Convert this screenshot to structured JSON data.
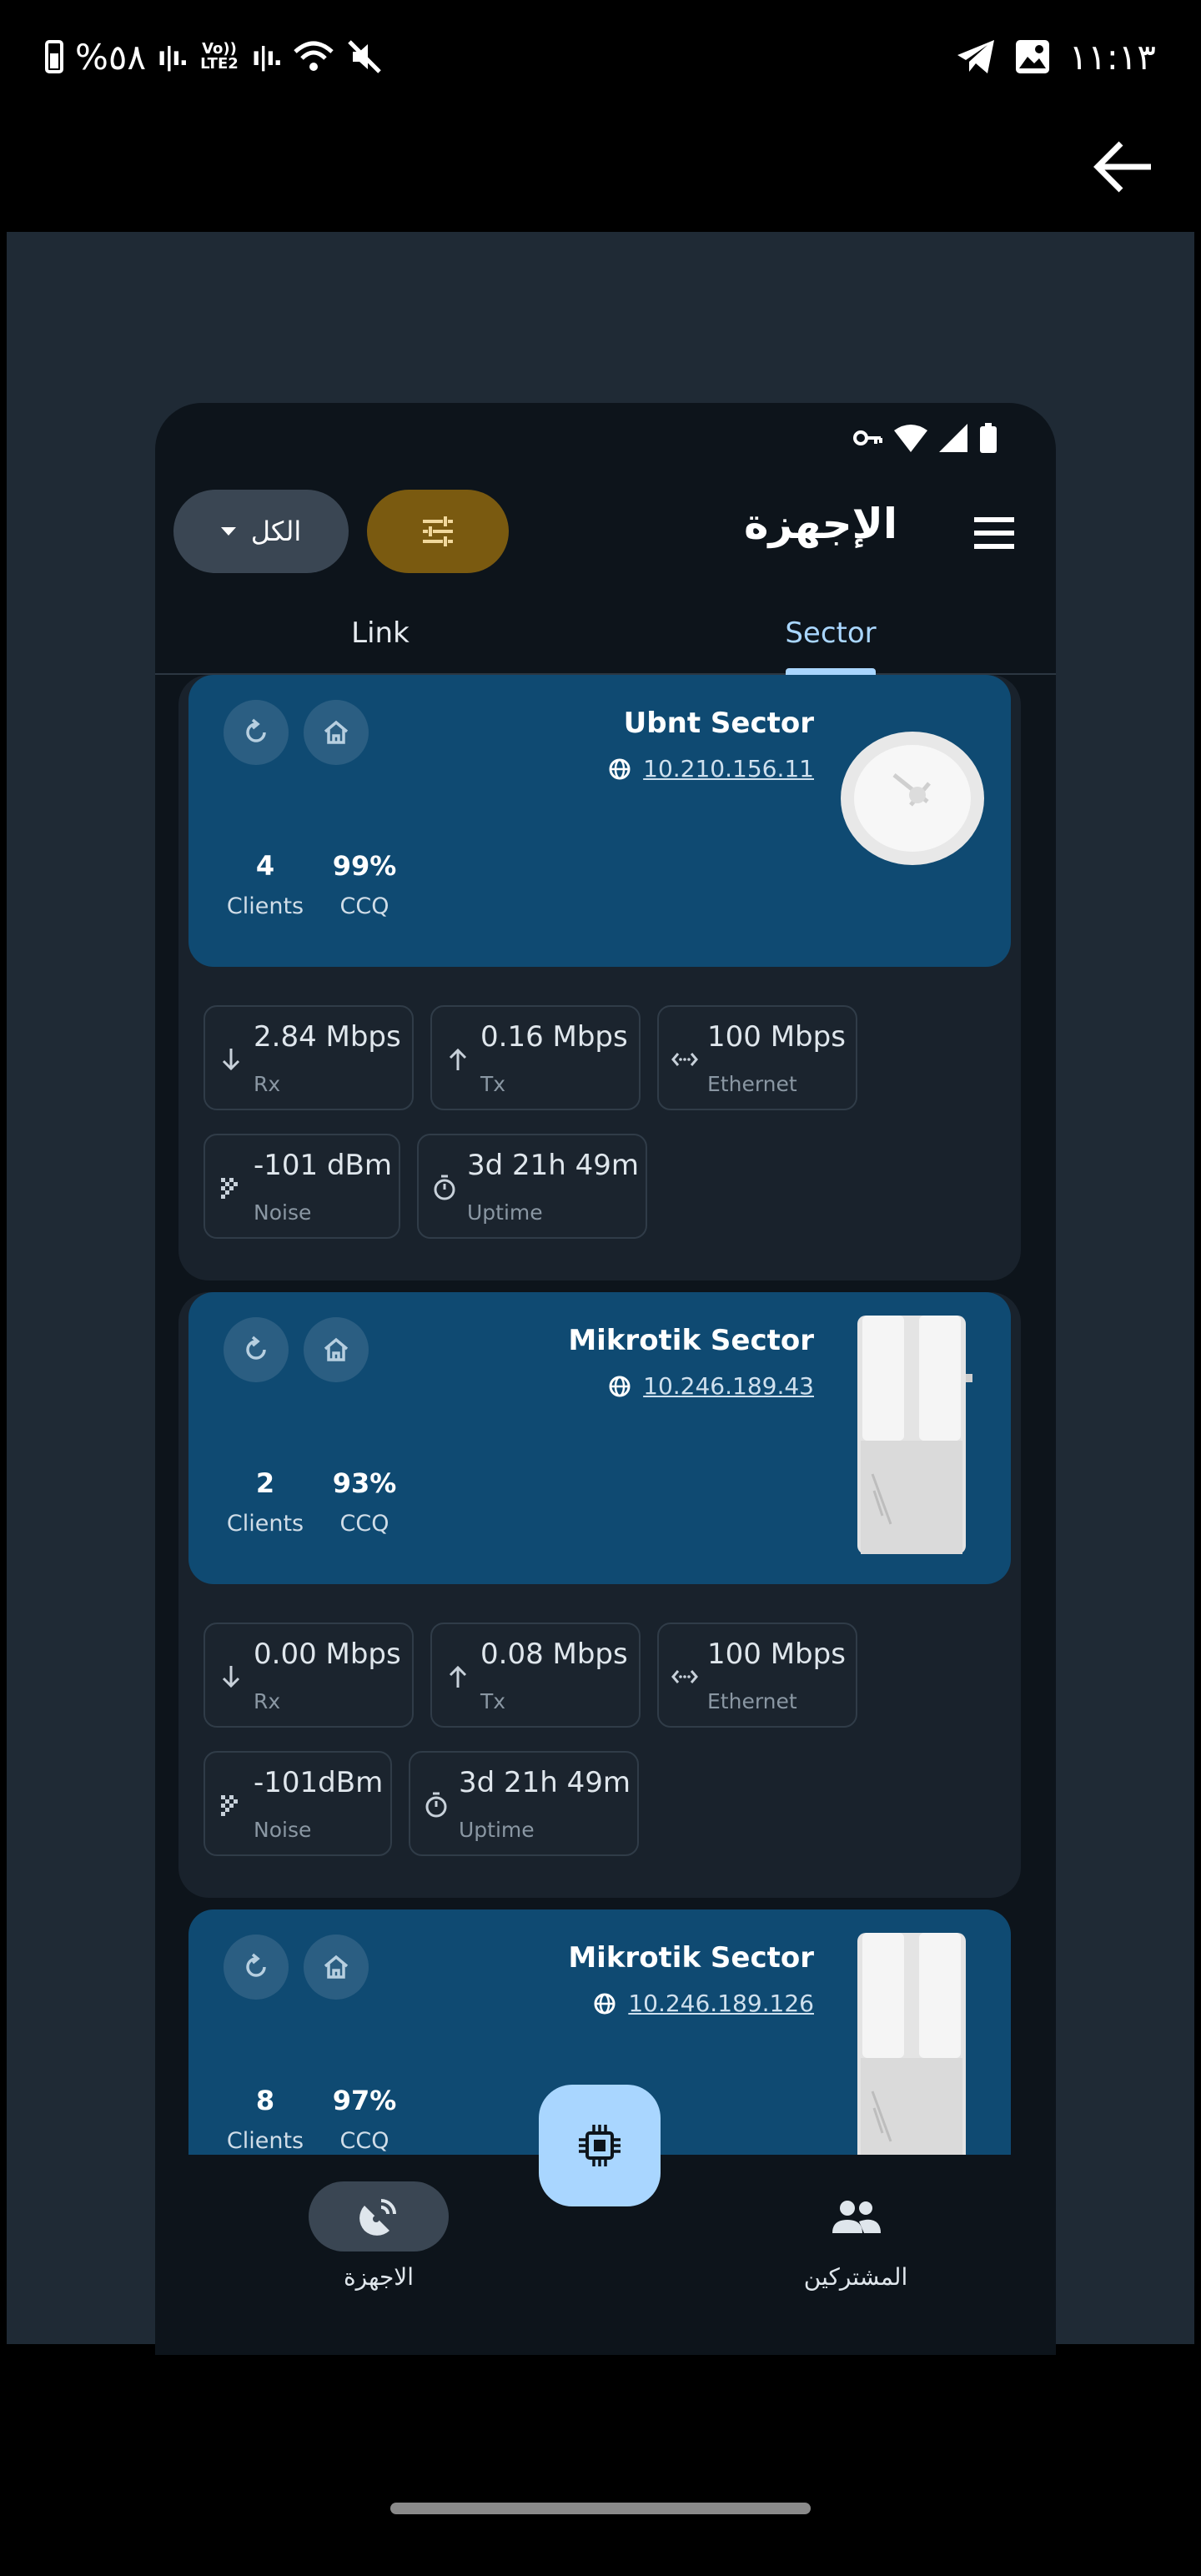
{
  "outer_status": {
    "battery": "%٥٨",
    "lte_label": "Vo)) LTE2",
    "time": "١١:١٣"
  },
  "app": {
    "title": "الإجهزة",
    "filter_dropdown_label": "الكل",
    "tabs": [
      {
        "label": "Link"
      },
      {
        "label": "Sector",
        "selected": true
      }
    ]
  },
  "devices": [
    {
      "name": "Ubnt Sector",
      "ip": "10.210.156.11",
      "type": "dish",
      "clients": "4",
      "clients_label": "Clients",
      "ccq": "99%",
      "ccq_label": "CCQ",
      "metrics": [
        {
          "value": "2.84 Mbps",
          "label": "Rx",
          "icon": "arrow-down-icon"
        },
        {
          "value": "0.16 Mbps",
          "label": "Tx",
          "icon": "arrow-up-icon"
        },
        {
          "value": "100 Mbps",
          "label": "Ethernet",
          "icon": "ethernet-icon"
        },
        {
          "value": "-101 dBm",
          "label": "Noise",
          "icon": "noise-icon"
        },
        {
          "value": "3d 21h 49m",
          "label": "Uptime",
          "icon": "timer-icon"
        }
      ]
    },
    {
      "name": "Mikrotik Sector",
      "ip": "10.246.189.43",
      "type": "box",
      "clients": "2",
      "clients_label": "Clients",
      "ccq": "93%",
      "ccq_label": "CCQ",
      "metrics": [
        {
          "value": "0.00 Mbps",
          "label": "Rx",
          "icon": "arrow-down-icon"
        },
        {
          "value": "0.08 Mbps",
          "label": "Tx",
          "icon": "arrow-up-icon"
        },
        {
          "value": "100 Mbps",
          "label": "Ethernet",
          "icon": "ethernet-icon"
        },
        {
          "value": "-101dBm",
          "label": "Noise",
          "icon": "noise-icon"
        },
        {
          "value": "3d 21h 49m",
          "label": "Uptime",
          "icon": "timer-icon"
        }
      ]
    },
    {
      "name": "Mikrotik Sector",
      "ip": "10.246.189.126",
      "type": "box",
      "clients": "8",
      "clients_label": "Clients",
      "ccq": "97%",
      "ccq_label": "CCQ"
    }
  ],
  "bottom_nav": [
    {
      "label": "الاجهزة",
      "icon": "satellite-icon",
      "selected": true
    },
    {
      "label": "المشتركين",
      "icon": "people-icon"
    }
  ],
  "colors": {
    "card": "#0f4a72",
    "accent": "#a9d6ff",
    "filter_button": "#7a5a10",
    "background": "#0d141b"
  }
}
